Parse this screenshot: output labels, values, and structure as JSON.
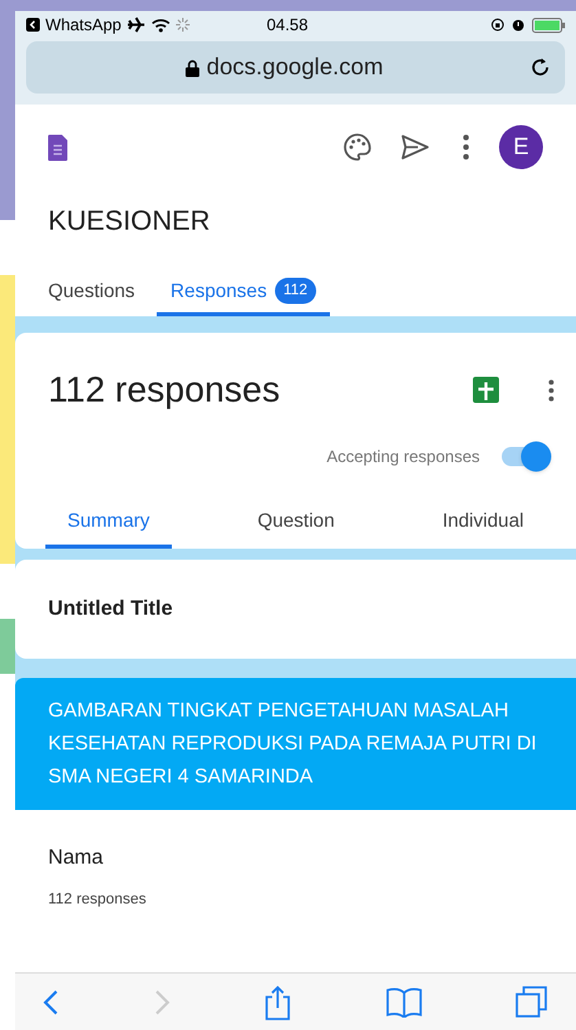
{
  "status_bar": {
    "back_app": "WhatsApp",
    "time": "04.58"
  },
  "browser": {
    "url": "docs.google.com"
  },
  "app_bar": {
    "avatar_letter": "E"
  },
  "form": {
    "title": "KUESIONER",
    "tabs": [
      {
        "label": "Questions",
        "selected": false
      },
      {
        "label": "Responses",
        "selected": true,
        "badge": "112"
      }
    ]
  },
  "responses": {
    "count": "112 responses",
    "accepting": {
      "label": "Accepting responses",
      "on": true
    },
    "view_tabs": [
      {
        "label": "Summary",
        "selected": true
      },
      {
        "label": "Question",
        "selected": false
      },
      {
        "label": "Individual",
        "selected": false
      }
    ]
  },
  "title_card": {
    "title": "Untitled Title"
  },
  "section": {
    "title": "GAMBARAN TINGKAT PENGETAHUAN MASALAH KESEHATAN REPRODUKSI PADA REMAJA PUTRI DI SMA NEGERI 4 SAMARINDA"
  },
  "question": {
    "title": "Nama",
    "count": "112 responses"
  },
  "toolbar": {
    "back_disabled": false,
    "forward_disabled": true
  }
}
